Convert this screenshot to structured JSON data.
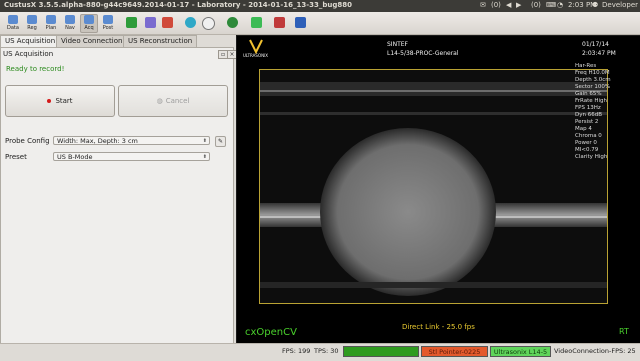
{
  "window": {
    "title": "CustusX 3.5.5.alpha-880-g44c9649.2014-01-17 - Laboratory - 2014-01-16_13-33_bug880",
    "indicators": {
      "mail_count": "(0)",
      "info_count": "(0)",
      "time": "2:03 PM",
      "user": "Developer"
    }
  },
  "toolbar": {
    "items": [
      {
        "label": "Data",
        "icon": "data-icon",
        "color": "#5b8bd0"
      },
      {
        "label": "Reg",
        "icon": "reg-icon",
        "color": "#5b8bd0"
      },
      {
        "label": "Plan",
        "icon": "plan-icon",
        "color": "#5b8bd0"
      },
      {
        "label": "Nav",
        "icon": "nav-icon",
        "color": "#5b8bd0"
      },
      {
        "label": "Acq",
        "icon": "acq-icon",
        "color": "#5b8bd0"
      },
      {
        "label": "Post",
        "icon": "post-icon",
        "color": "#5b8bd0"
      }
    ]
  },
  "left_panel": {
    "tabs": [
      "US Acquisition",
      "Video Connection",
      "US Reconstruction"
    ],
    "title": "US Acquisition",
    "status": "Ready to record!",
    "start_label": "Start",
    "cancel_label": "Cancel",
    "probe_config_label": "Probe Config",
    "probe_config_value": "Width: Max, Depth: 3 cm",
    "preset_label": "Preset",
    "preset_value": "US B-Mode"
  },
  "view": {
    "brand": "ULTRASONIX",
    "header_center_1": "SINTEF",
    "header_center_2": "L14-5/38-PROC-General",
    "date": "01/17/14",
    "time": "2:03:47 PM",
    "params": [
      "Har-Res",
      "Freq H10.0M",
      "Depth 3.0cm",
      "Sector 100%",
      "Gain 65%",
      "FrRate High",
      "FPS 13Hz",
      "Dyn 66dB",
      "Persist 2",
      "Map 4",
      "Chroma 0",
      "Power 0",
      "MI<0.79",
      "Clarity High"
    ],
    "overlay_left": "cxOpenCV",
    "overlay_center": "Direct Link - 25.0 fps",
    "overlay_right": "RT"
  },
  "status_bar": {
    "fps": "FPS: 199",
    "tps": "TPS: 30",
    "tool_pointer": "Stl Pointer-0225",
    "tool_probe": "Ultrasonix L14-5",
    "video_fps": "VideoConnection-FPS: 25",
    "colors": {
      "green": "#2f9b1f",
      "orange": "#e3592c",
      "lightgreen": "#5fd45a"
    }
  }
}
